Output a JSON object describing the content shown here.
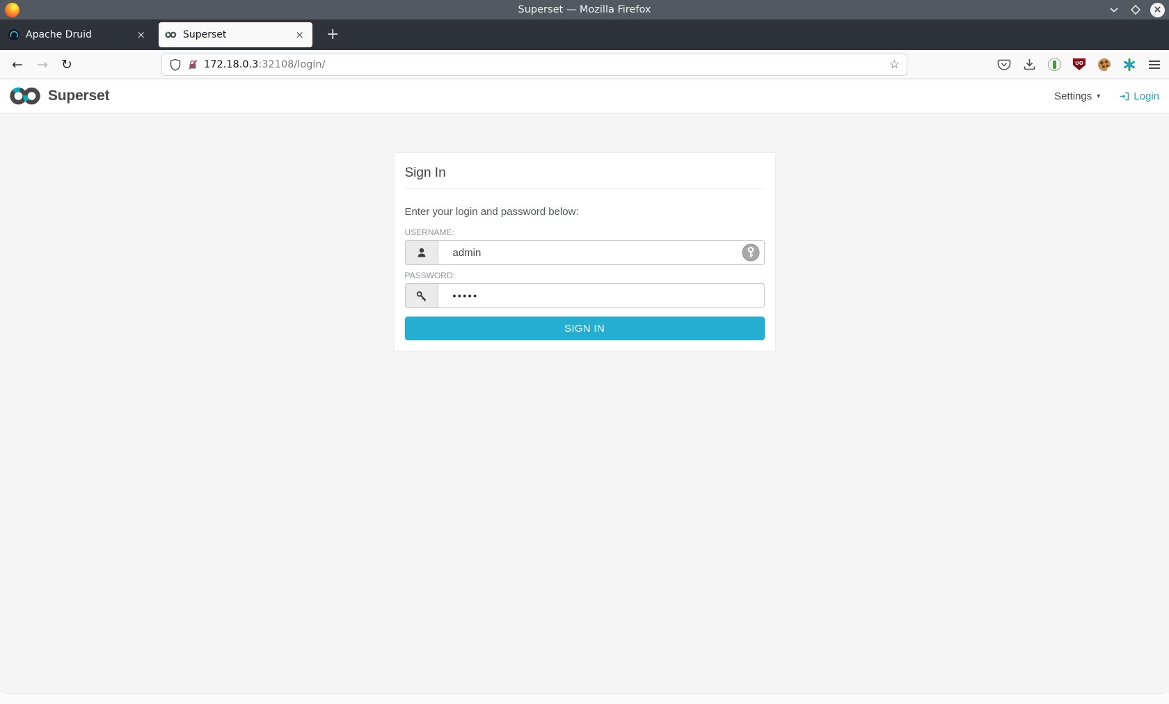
{
  "window": {
    "title": "Superset — Mozilla Firefox"
  },
  "tabs": [
    {
      "title": "Apache Druid"
    },
    {
      "title": "Superset"
    }
  ],
  "toolbar": {
    "url_host": "172.18.0.3",
    "url_rest": ":32108/login/"
  },
  "icons": {
    "back": "←",
    "forward": "→",
    "reload": "↻",
    "star": "☆",
    "close_tab": "×",
    "new_tab": "+",
    "window_close": "×",
    "settings_caret": "▾",
    "ublock_text": "UO"
  },
  "navbar": {
    "brand": "Superset",
    "settings_label": "Settings",
    "login_label": "Login"
  },
  "login": {
    "card_title": "Sign In",
    "subtitle": "Enter your login and password below:",
    "username_label": "USERNAME:",
    "username_value": "admin",
    "password_label": "PASSWORD:",
    "password_value": "•••••",
    "submit_label": "SIGN IN"
  },
  "colors": {
    "accent": "#20A7C9",
    "button": "#24AFD2"
  }
}
